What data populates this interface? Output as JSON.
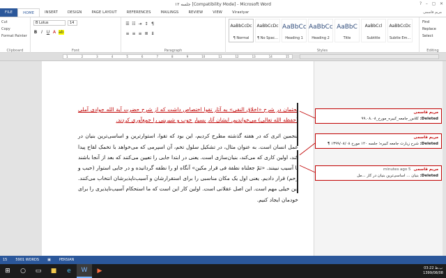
{
  "window": {
    "title": "جلسه ۱۲ [Compatibility Mode] - Microsoft Word",
    "user": "مریم قاسمی"
  },
  "tabs": [
    "FILE",
    "HOME",
    "INSERT",
    "DESIGN",
    "PAGE LAYOUT",
    "REFERENCES",
    "MAILINGS",
    "REVIEW",
    "VIEW",
    "Virastyar"
  ],
  "clipboard": {
    "cut": "Cut",
    "copy": "Copy",
    "format_painter": "Format Painter",
    "label": "Clipboard"
  },
  "font": {
    "name": "B Lotus",
    "size": "14",
    "label": "Font"
  },
  "paragraph": {
    "label": "Paragraph"
  },
  "styles": {
    "label": "Styles",
    "items": [
      {
        "preview": "AaBbCcDc",
        "name": "¶ Normal"
      },
      {
        "preview": "AaBbCcDc",
        "name": "¶ No Spac..."
      },
      {
        "preview": "AaBbCc",
        "name": "Heading 1"
      },
      {
        "preview": "AaBbCc",
        "name": "Heading 2"
      },
      {
        "preview": "AaBbC",
        "name": "Title"
      },
      {
        "preview": "AaBbCcl",
        "name": "Subtitle"
      },
      {
        "preview": "AaBbCcDc",
        "name": "Subtle Em..."
      }
    ]
  },
  "editing": {
    "find": "Find",
    "replace": "Replace",
    "select": "Select",
    "label": "Editing"
  },
  "ruler": {
    "ticks": [
      "1",
      "2",
      "3",
      "4",
      "5",
      "6",
      "7",
      "8",
      "9",
      "10",
      "11",
      "12",
      "13",
      "14",
      "15"
    ]
  },
  "document": {
    "para1": "بحثمان در شرح «اخلاق النقی» به آثار تقوا اختصاص داشت که از شرح حضرت آیة الله جوادی آملی (حفظه الله تعالی) می‌خواندیم. ایشان آثار بسیار خوب و شیرینی را جمع‌آوری کردند.",
    "para2": "پنجمین اثری که در هفته گذشته مطرح کردیم، این بود که تقوا، استوارترین و اساسی‌ترین بنیان در عمل انسان است. به عنوان مثال، در تشکیل سلول تخم، آن اسپرمی که می‌خواهد با تخمک لقاح پیدا کند، اولین کاری که می‌کند، بنیان‌سازی است. یعنی در ابتدا جایی را تعیین می‌کنند که بعد از آنجا باشند تا آسیب نبینند. «ثمّ جعلناه نطفة فی قرار مکین» آنگاه او را نطفه گردانیده و در جایی استوار (حبب و رحم) قرار دادیم. یعنی اول یک مکان مناسبی را برای استقرارشان و آسیب‌ناپذیرشان انتخاب می‌کنند. این خیلی مهم است. این اصل عقلانی است. اولین کار این است که ما استحکام آسیب‌ناپذیری را برای خودمان ایجاد کنیم."
  },
  "comments": [
    {
      "author": "مریم قاسمی",
      "time": "",
      "deleted": "Deleted:",
      "text": "کلاس_جامعه_کبیره_مورخ_۹۹.۰۸.۰۸"
    },
    {
      "author": "مریم قاسمی",
      "time": "",
      "deleted": "Deleted:",
      "text": "شرح زیارت جامعه کبیره؛ جلسه ۱۲۰ مورخ ۱۳۹۹/۰۸/۰۸ ¶"
    },
    {
      "author": "مریم قاسمی",
      "time": "5 minutes ago",
      "deleted": "Deleted:",
      "text": "بنیان ... اساسی‌ترین بنیان در کار ...مل"
    }
  ],
  "status": {
    "page": "15",
    "words": "5901 WORDS",
    "language": "PERSIAN"
  },
  "taskbar": {
    "time": "03:22 ب.ظ",
    "date": "1399/08/08"
  },
  "colors": {
    "accent": "#2b579a",
    "revision": "#c00000"
  }
}
